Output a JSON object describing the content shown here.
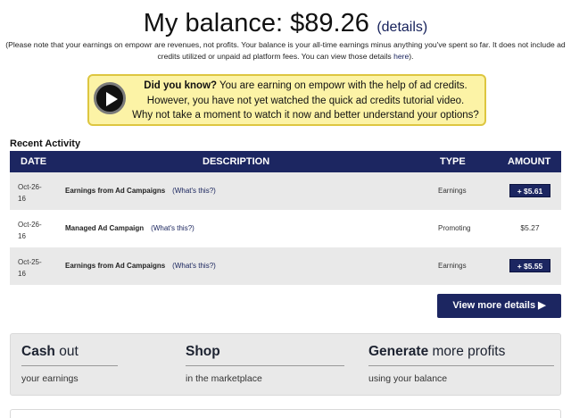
{
  "balance": {
    "title": "My balance: $89.26",
    "details_link": "(details)"
  },
  "note": {
    "text": "(Please note that your earnings on empowr are revenues, not profits. Your balance is your all-time earnings minus anything you've spent so far. It does not include ad credits utilized or unpaid ad platform fees. You can view those details ",
    "link": "here",
    "end": ")."
  },
  "tip": {
    "icon": "play-icon",
    "bold": "Did you know?",
    "line1": " You are earning on empowr with the help of ad credits.",
    "line2": "However, you have not yet watched the quick ad credits tutorial video.",
    "line3": "Why not take a moment to watch it now and better understand your options?",
    "colors": {
      "bg": "#fcf3a6",
      "border": "#ddc640"
    }
  },
  "recent": {
    "label": "Recent Activity",
    "headers": {
      "date": "DATE",
      "description": "DESCRIPTION",
      "type": "TYPE",
      "amount": "AMOUNT"
    },
    "rows": [
      {
        "date": "Oct-26-16",
        "description": "Earnings from Ad Campaigns",
        "link": "(What's this?)",
        "type": "Earnings",
        "amount": "+ $5.61"
      },
      {
        "date": "Oct-26-16",
        "description": "Managed Ad Campaign",
        "link": "(What's this?)",
        "type": "Promoting",
        "amount": "$5.27"
      },
      {
        "date": "Oct-25-16",
        "description": "Earnings from Ad Campaigns",
        "link": "(What's this?)",
        "type": "Earnings",
        "amount": "+ $5.55"
      }
    ],
    "more_button": "View more details ▶"
  },
  "actions": [
    {
      "bold": "Cash",
      "rest": " out",
      "sub": "your earnings"
    },
    {
      "bold": "Shop",
      "rest": "",
      "sub": "in the marketplace"
    },
    {
      "bold": "Generate",
      "rest": " more profits",
      "sub": "using your balance"
    }
  ],
  "colors": {
    "navy": "#1c2661",
    "row_shade": "#e9e9e9"
  }
}
